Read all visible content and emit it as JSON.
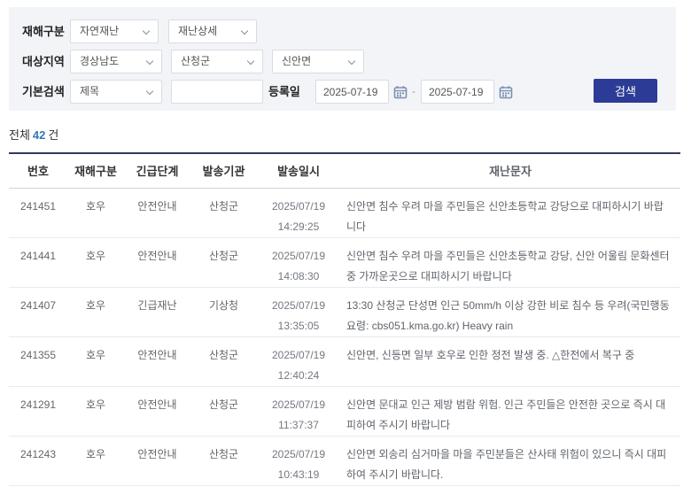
{
  "filters": {
    "disaster_label": "재해구분",
    "disaster_type_value": "자연재난",
    "disaster_detail_value": "재난상세",
    "region_label": "대상지역",
    "region_province_value": "경상남도",
    "region_county_value": "산청군",
    "region_town_value": "신안면",
    "search_label": "기본검색",
    "search_field_value": "제목",
    "search_input_value": "",
    "date_label": "등록일",
    "date_from": "2025-07-19",
    "date_to": "2025-07-19",
    "date_separator": "-",
    "search_button_label": "검색"
  },
  "summary": {
    "total_label": "전체",
    "total_count": "42",
    "unit_label": "건"
  },
  "table": {
    "headers": {
      "no": "번호",
      "type": "재해구분",
      "level": "긴급단계",
      "org": "발송기관",
      "datetime": "발송일시",
      "message": "재난문자"
    },
    "rows": [
      {
        "no": "241451",
        "type": "호우",
        "level": "안전안내",
        "org": "산청군",
        "date": "2025/07/19",
        "time": "14:29:25",
        "message": "신안면 침수 우려 마을 주민들은 신안초등학교 강당으로 대피하시기 바랍니다"
      },
      {
        "no": "241441",
        "type": "호우",
        "level": "안전안내",
        "org": "산청군",
        "date": "2025/07/19",
        "time": "14:08:30",
        "message": "신안면 침수 우려 마을 주민들은 신안초등학교 강당, 신안 어울림 문화센터 중 가까운곳으로 대피하시기 바랍니다"
      },
      {
        "no": "241407",
        "type": "호우",
        "level": "긴급재난",
        "org": "기상청",
        "date": "2025/07/19",
        "time": "13:35:05",
        "message": "13:30 산청군 단성면 인근 50mm/h 이상 강한 비로 침수 등 우려(국민행동요령: cbs051.kma.go.kr) Heavy rain"
      },
      {
        "no": "241355",
        "type": "호우",
        "level": "안전안내",
        "org": "산청군",
        "date": "2025/07/19",
        "time": "12:40:24",
        "message": "신안면, 신등면 일부 호우로 인한 정전 발생 중. △한전에서 복구 중"
      },
      {
        "no": "241291",
        "type": "호우",
        "level": "안전안내",
        "org": "산청군",
        "date": "2025/07/19",
        "time": "11:37:37",
        "message": "신안면 문대교 인근 제방 범람 위험. 인근 주민들은 안전한 곳으로 즉시 대피하여 주시기 바랍니다"
      },
      {
        "no": "241243",
        "type": "호우",
        "level": "안전안내",
        "org": "산청군",
        "date": "2025/07/19",
        "time": "10:43:19",
        "message": "신안면 외송리 심거마을 마을 주민분들은 산사태 위험이 있으니 즉시 대피하여 주시기 바랍니다."
      }
    ]
  },
  "colors": {
    "search_button_bg": "#2c3c96",
    "count_accent": "#3577b8",
    "table_top_border": "#2f3a5f",
    "panel_bg": "#f2f4f7"
  }
}
